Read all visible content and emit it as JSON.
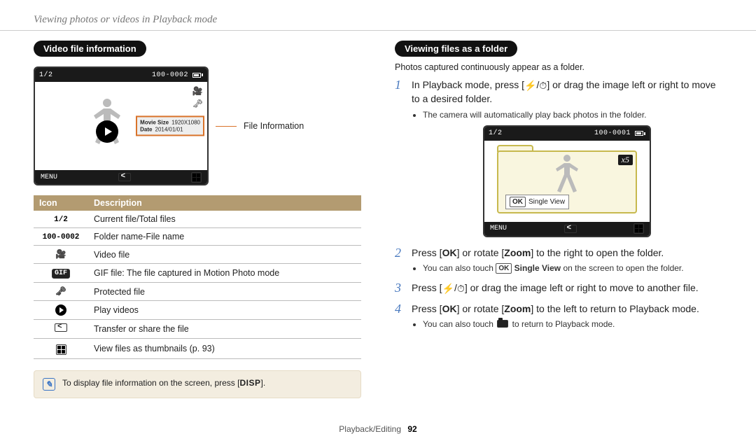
{
  "header": {
    "title": "Viewing photos or videos in Playback mode"
  },
  "left": {
    "section_title": "Video file information",
    "lcd": {
      "counter": "1/2",
      "filecode": "100-0002",
      "menu": "MENU",
      "info": {
        "k1": "Movie Size",
        "v1": "1920X1080",
        "k2": "Date",
        "v2": "2014/01/01"
      }
    },
    "callout": "File Information",
    "table": {
      "h_icon": "Icon",
      "h_desc": "Description",
      "rows": [
        {
          "icon_text": "1/2",
          "desc": "Current file/Total files"
        },
        {
          "icon_text": "100-0002",
          "desc": "Folder name-File name"
        },
        {
          "icon_kind": "video",
          "desc": "Video file"
        },
        {
          "icon_kind": "gif",
          "icon_text": "GIF",
          "desc": "GIF file: The file captured in Motion Photo mode"
        },
        {
          "icon_kind": "lock",
          "desc": "Protected file"
        },
        {
          "icon_kind": "play",
          "desc": "Play videos"
        },
        {
          "icon_kind": "share",
          "desc": "Transfer or share the file"
        },
        {
          "icon_kind": "grid",
          "desc": "View files as thumbnails (p. 93)"
        }
      ]
    },
    "note": {
      "pre": "To display file information on the screen, press [",
      "chip": "DISP",
      "post": "]."
    }
  },
  "right": {
    "section_title": "Viewing files as a folder",
    "intro": "Photos captured continuously appear as a folder.",
    "lcd": {
      "counter": "1/2",
      "filecode": "100-0001",
      "menu": "MENU",
      "count_badge": "x5",
      "ok_label": "OK",
      "ok_text": "Single View"
    },
    "steps": {
      "s1a": "In Playback mode, press [",
      "s1b": "] or drag the image left or right to move to a desired folder.",
      "s1_bul": "The camera will automatically play back photos in the folder.",
      "s2a": "Press [",
      "s2b": "] or rotate [",
      "s2_zoom": "Zoom",
      "s2c": "] to the right to open the folder.",
      "s2_bul_a": "You can also touch ",
      "s2_bul_ok": "OK",
      "s2_bul_single": "Single View",
      "s2_bul_b": " on the screen to open the folder.",
      "s3a": "Press [",
      "s3b": "] or drag the image left or right to move to another file.",
      "s4a": "Press [",
      "s4b": "] or rotate [",
      "s4_zoom": "Zoom",
      "s4c": "] to the left to return to Playback mode.",
      "s4_bul_a": "You can also touch ",
      "s4_bul_b": " to return to Playback mode."
    }
  },
  "footer": {
    "section": "Playback/Editing",
    "page": "92"
  }
}
